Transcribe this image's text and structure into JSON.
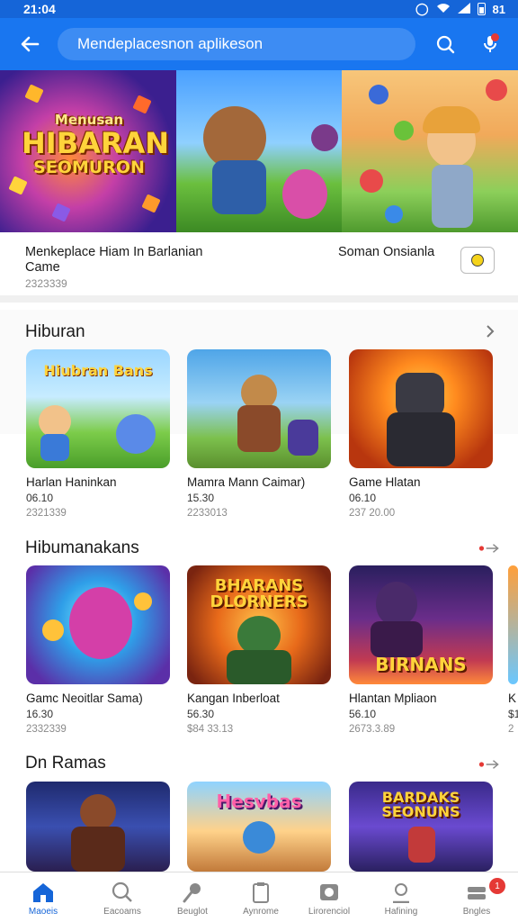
{
  "status_bar": {
    "time": "21:04",
    "battery": "81"
  },
  "search": {
    "query": "Mendeplacesnon aplikeson"
  },
  "banner": {
    "line1": "Menusan",
    "line2": "HIBARAN",
    "line3": "SEOMURON"
  },
  "featured": {
    "title": "Menkeplace Hiam In Barlanian Came",
    "meta": "2323339",
    "right_label": "Soman Onsianla"
  },
  "sections": [
    {
      "title": "Hiburan",
      "cards": [
        {
          "caption": "Hiubran Bans",
          "title": "Harlan Haninkan",
          "rating": "06.10",
          "meta": "2321339"
        },
        {
          "caption": "",
          "title": "Mamra Mann Caimar)",
          "rating": "15.30",
          "meta": "2233013"
        },
        {
          "caption": "",
          "title": "Game Hlatan",
          "rating": "06.10",
          "meta": "237 20.00"
        }
      ]
    },
    {
      "title": "Hibumanakans",
      "cards": [
        {
          "caption": "",
          "title": "Gamc Neoitlar Sama)",
          "rating": "16.30",
          "meta": "2332339"
        },
        {
          "caption": "BHARANS DLORNERS",
          "title": "Kangan Inberloat",
          "rating": "56.30",
          "meta": "$84 33.13"
        },
        {
          "caption": "BIRNANS",
          "title": "Hlantan Mpliaon",
          "rating": "56.10",
          "meta": "2673.3.89"
        }
      ],
      "peek": {
        "title": "K",
        "rating": "$1",
        "meta": "2"
      }
    },
    {
      "title": "Dn Ramas",
      "cards": [
        {
          "caption": ""
        },
        {
          "caption": "Hesvbas"
        },
        {
          "caption": "BARDAKS SEONUNS"
        }
      ]
    }
  ],
  "nav": [
    {
      "label": "Maoeis",
      "icon": "home-icon"
    },
    {
      "label": "Eacoams",
      "icon": "search-icon"
    },
    {
      "label": "Beuglot",
      "icon": "mic-icon"
    },
    {
      "label": "Aynrome",
      "icon": "clipboard-icon"
    },
    {
      "label": "Lirorenciol",
      "icon": "store-icon"
    },
    {
      "label": "Hafining",
      "icon": "profile-icon"
    },
    {
      "label": "Bngles",
      "icon": "stack-icon",
      "badge": "1"
    }
  ],
  "colors": {
    "primary": "#1976f0",
    "status": "#1565d8",
    "active": "#1565d8",
    "badge": "#e53935"
  }
}
